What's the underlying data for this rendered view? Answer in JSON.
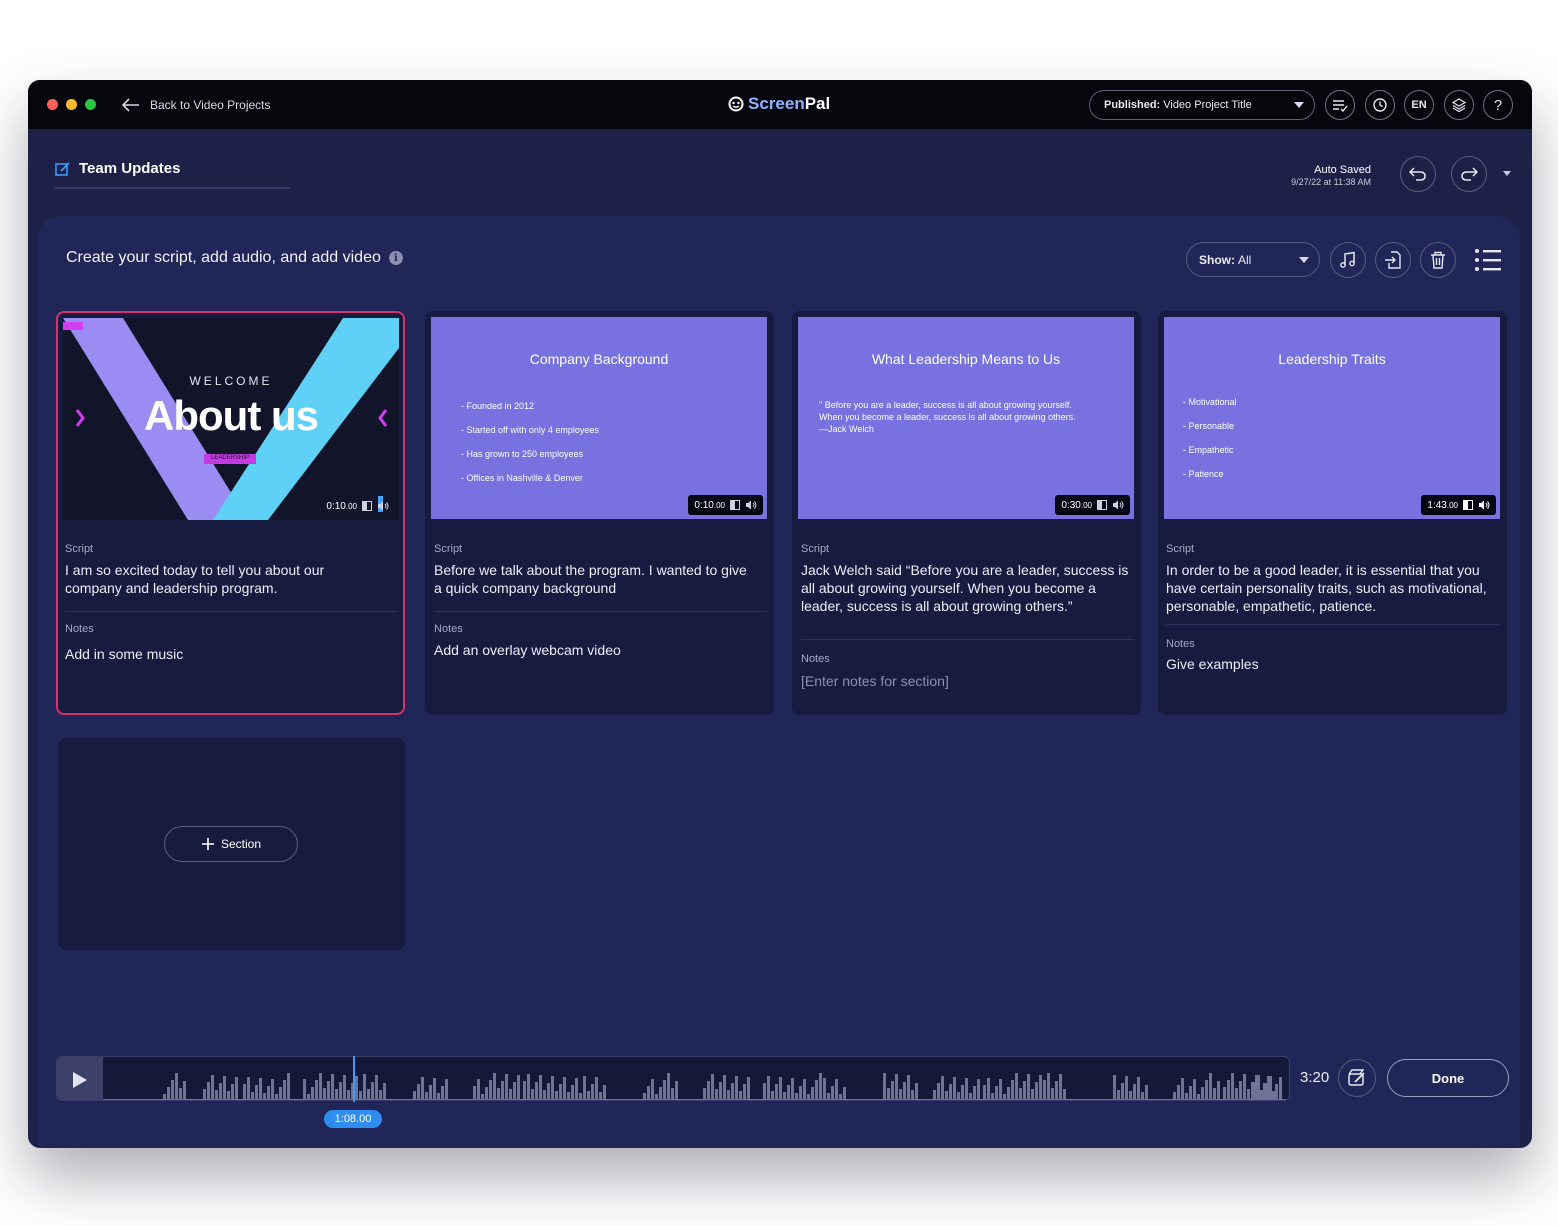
{
  "window": {
    "back_label": "Back to Video Projects",
    "logo": {
      "a": "Screen",
      "b": "Pal"
    },
    "publish": {
      "prefix": "Published:",
      "title": "Video Project Title"
    },
    "lang": "EN",
    "help": "?"
  },
  "project": {
    "title": "Team Updates",
    "autosave_label": "Auto Saved",
    "autosave_time": "9/27/22 at 11:38 AM"
  },
  "panel": {
    "heading": "Create your script, add audio, and add video",
    "show": {
      "prefix": "Show:",
      "value": "All"
    }
  },
  "labels": {
    "script": "Script",
    "notes": "Notes"
  },
  "cards": [
    {
      "thumb": {
        "welcome": "WELCOME",
        "headline": "About us",
        "tag": "LEADERSHIP"
      },
      "duration": "0:10",
      "duration_frac": ".00",
      "script": "I am so excited today to tell you about our company and leadership program.",
      "notes": "Add in some music"
    },
    {
      "thumb": {
        "title": "Company Background",
        "bullets": [
          "- Founded in 2012",
          "- Started off with only 4 employees",
          "- Has grown to 250 employees",
          "- Offices in Nashville & Denver"
        ]
      },
      "duration": "0:10",
      "duration_frac": ".00",
      "script": "Before we talk about the program. I wanted to give a quick company background",
      "notes": "Add an overlay webcam video"
    },
    {
      "thumb": {
        "title": "What Leadership Means to Us",
        "quote": "\" Before you are a leader, success is all about growing yourself. When you become a leader, success is all about growing others. —Jack Welch"
      },
      "duration": "0:30",
      "duration_frac": ".00",
      "script": "Jack Welch said “Before you are a leader, success is all about growing yourself. When you become a leader, success is all about growing others.”",
      "notes": "[Enter notes for section]"
    },
    {
      "thumb": {
        "title": "Leadership Traits",
        "bullets": [
          "- Motivational",
          "- Personable",
          "- Empathetic",
          "- Patience"
        ]
      },
      "duration": "1:43",
      "duration_frac": ".00",
      "script": "In order to be a good leader, it is essential that you have certain personality traits, such as motivational, personable, empathetic, patience.",
      "notes": "Give examples"
    }
  ],
  "add_section_label": "Section",
  "timeline": {
    "playhead_time": "1:08.00",
    "playhead_position_seconds": 68,
    "total_time": "3:20",
    "done_label": "Done"
  },
  "colors": {
    "titlebar": "#06070c",
    "window_bg": "#1d2147",
    "panel_bg": "#202658",
    "card_bg": "#171b3f",
    "slide_purple": "#7772e0",
    "selected_border": "#d2356b",
    "accent_blue": "#2f8cf1"
  },
  "icons": [
    "back-arrow-icon",
    "edit-icon",
    "captions-icon",
    "history-icon",
    "layers-icon",
    "help-icon",
    "undo-icon",
    "redo-icon",
    "music-icon",
    "import-icon",
    "trash-icon",
    "list-icon",
    "play-icon",
    "plus-icon",
    "sound-icon",
    "tool-icon"
  ]
}
